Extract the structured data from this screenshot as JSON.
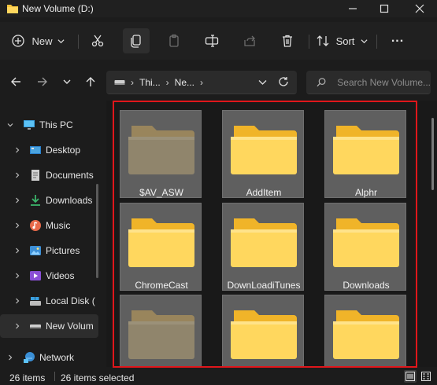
{
  "window": {
    "title": "New Volume (D:)"
  },
  "commandbar": {
    "new_label": "New",
    "sort_label": "Sort",
    "more_label": "..."
  },
  "address": {
    "crumbs": [
      "Thi...",
      "Ne..."
    ],
    "search_placeholder": "Search New Volume..."
  },
  "sidebar": {
    "items": [
      {
        "label": "This PC",
        "icon": "monitor-icon"
      },
      {
        "label": "Desktop",
        "icon": "desktop-icon"
      },
      {
        "label": "Documents",
        "icon": "documents-icon"
      },
      {
        "label": "Downloads",
        "icon": "download-icon"
      },
      {
        "label": "Music",
        "icon": "music-icon"
      },
      {
        "label": "Pictures",
        "icon": "pictures-icon"
      },
      {
        "label": "Videos",
        "icon": "videos-icon"
      },
      {
        "label": "Local Disk (",
        "icon": "local-disk-icon"
      },
      {
        "label": "New Volum",
        "icon": "drive-icon"
      },
      {
        "label": "Network",
        "icon": "network-icon"
      }
    ]
  },
  "folders": [
    {
      "name": "$AV_ASW",
      "hidden": true
    },
    {
      "name": "AddItem",
      "hidden": false
    },
    {
      "name": "Alphr",
      "hidden": false
    },
    {
      "name": "ChromeCast",
      "hidden": false
    },
    {
      "name": "DownLoadiTunes",
      "hidden": false
    },
    {
      "name": "Downloads",
      "hidden": false
    },
    {
      "name": "",
      "hidden": true
    },
    {
      "name": "",
      "hidden": false
    },
    {
      "name": "",
      "hidden": false
    }
  ],
  "status": {
    "items_count": "26 items",
    "selected_count": "26 items selected"
  },
  "colors": {
    "selection_frame": "#e0161b",
    "folder_yellow": "#f5c33b",
    "accent_blue": "#4aa3df"
  }
}
